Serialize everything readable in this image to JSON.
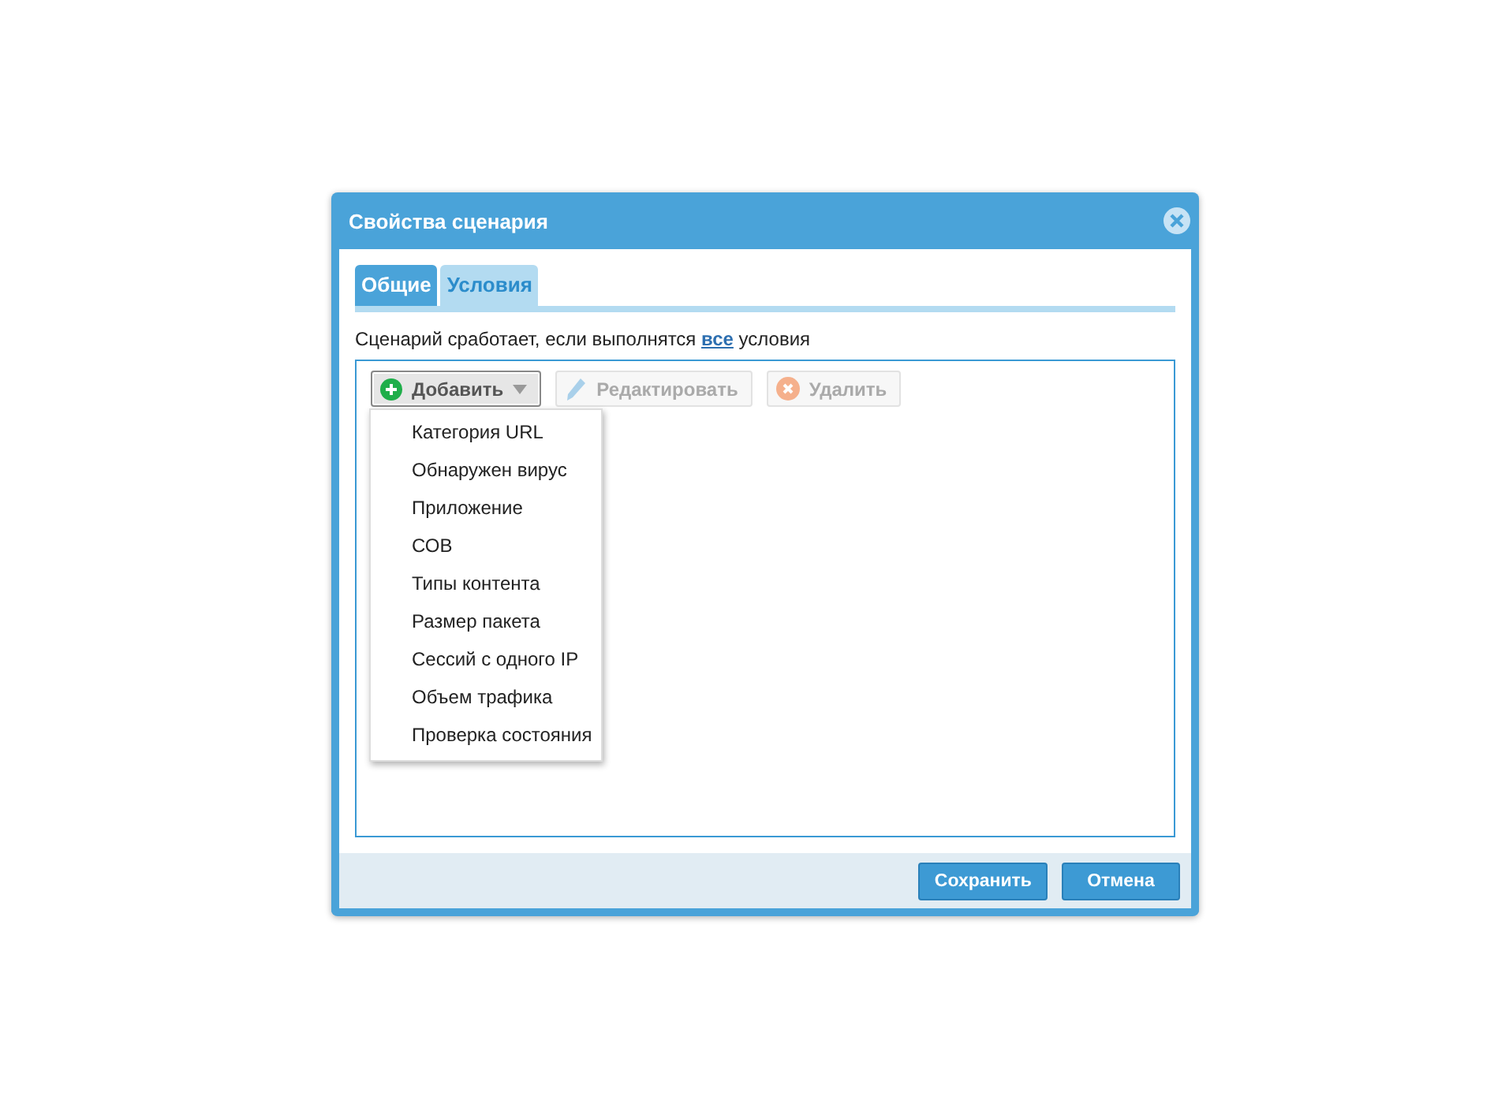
{
  "window": {
    "title": "Свойства сценария"
  },
  "tabs": [
    {
      "label": "Общие",
      "selected": false
    },
    {
      "label": "Условия",
      "selected": true
    }
  ],
  "description": {
    "before": "Сценарий сработает, если выполнятся ",
    "link": "все",
    "after": " условия"
  },
  "toolbar": [
    {
      "label": "Добавить",
      "kind": "add",
      "disabled": false,
      "expanded": true
    },
    {
      "label": "Редактировать",
      "kind": "edit",
      "disabled": true,
      "expanded": false
    },
    {
      "label": "Удалить",
      "kind": "delete",
      "disabled": true,
      "expanded": false
    }
  ],
  "menu": [
    "Категория URL",
    "Обнаружен вирус",
    "Приложение",
    "СОВ",
    "Типы контента",
    "Размер пакета",
    "Сессий с одного IP",
    "Объем трафика",
    "Проверка состояния"
  ],
  "buttons": [
    {
      "label": "Сохранить"
    },
    {
      "label": "Отмена"
    }
  ]
}
